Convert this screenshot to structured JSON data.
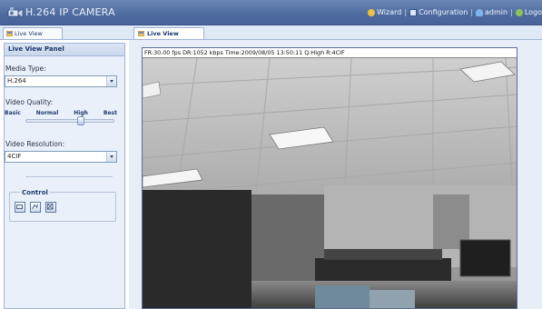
{
  "header": {
    "title": "H.264 IP CAMERA",
    "logo_icon": "camera-logo-icon",
    "nav": [
      {
        "label": "Wizard",
        "icon": "wizard-icon"
      },
      {
        "label": "Configuration",
        "icon": "configuration-icon"
      },
      {
        "label": "admin",
        "icon": "user-icon"
      },
      {
        "label": "Logo",
        "icon": "logout-icon"
      }
    ],
    "separator": "|"
  },
  "left_tab": {
    "label": "Live View",
    "icon": "live-view-tab-icon"
  },
  "panel": {
    "title": "Live View Panel",
    "media_type": {
      "label": "Media Type:",
      "value": "H.264"
    },
    "video_quality": {
      "label": "Video Quality:",
      "levels": [
        "Basic",
        "Normal",
        "High",
        "Best"
      ],
      "selected": "High"
    },
    "video_resolution": {
      "label": "Video Resolution:",
      "value": "4CIF"
    },
    "control": {
      "title": "Control",
      "buttons": [
        "snapshot-icon",
        "record-icon",
        "fullscreen-icon"
      ]
    }
  },
  "right_tab": {
    "label": "Live View",
    "icon": "live-view-tab-icon"
  },
  "video": {
    "status": "FR:30.00 fps  DR:1052 kbps Time:2009/08/05 13:50:11 Q:High R:4CIF"
  },
  "colors": {
    "header_bg": "#4e6b9e",
    "panel_bg": "#eaf0f9",
    "accent": "#17366b"
  }
}
